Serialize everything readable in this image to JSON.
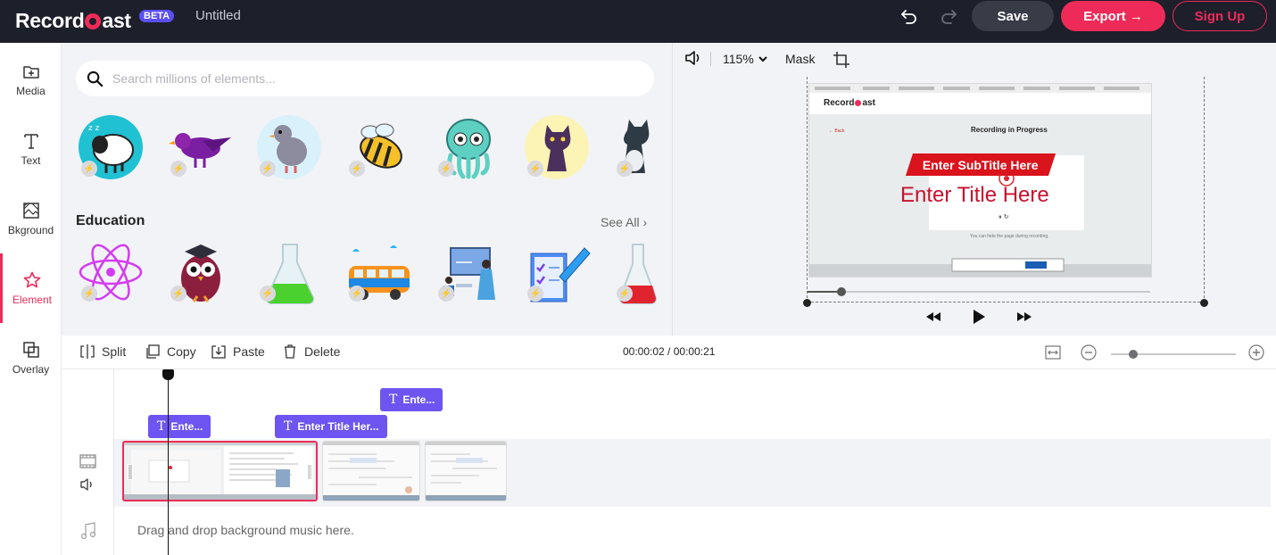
{
  "header": {
    "brand": "Record",
    "brand_suffix": "ast",
    "beta_badge": "BETA",
    "doc_title": "Untitled",
    "undo_icon": "undo-icon",
    "redo_icon": "redo-icon",
    "save_label": "Save",
    "export_label": "Export →",
    "signup_label": "Sign Up"
  },
  "sidebar": {
    "items": [
      {
        "label": "Media",
        "icon": "media-add-icon"
      },
      {
        "label": "Text",
        "icon": "text-icon"
      },
      {
        "label": "Bkground",
        "icon": "background-icon"
      },
      {
        "label": "Element",
        "icon": "star-icon",
        "active": true
      },
      {
        "label": "Overlay",
        "icon": "overlay-icon"
      }
    ]
  },
  "elements_panel": {
    "search_placeholder": "Search millions of elements...",
    "row1_items": [
      "sleeping-sheep",
      "purple-bird",
      "pigeon",
      "bee",
      "octopus",
      "cat",
      "cat-silhouette"
    ],
    "section_title": "Education",
    "see_all": "See All",
    "row2_items": [
      "atom",
      "owl-graduate",
      "flask",
      "school-bus",
      "teacher",
      "checklist-pencil",
      "test-tube"
    ]
  },
  "preview": {
    "zoom": "115%",
    "mask_label": "Mask",
    "video": {
      "browser_logo": "Record",
      "browser_logo_suffix": "ast",
      "recording_heading": "Recording in Progress",
      "back_link": "← Back",
      "subtitle_overlay": "Enter SubTitle Here",
      "title_overlay": "Enter Title Here",
      "hint": "You can hide the page during recording."
    },
    "progress": 0.1
  },
  "timeline": {
    "tools": [
      "Split",
      "Copy",
      "Paste",
      "Delete"
    ],
    "current_time": "00:00:02",
    "total_time": "00:00:21",
    "zoom_level": 0.18,
    "text_clips": [
      "Ente...",
      "Enter Title Her...",
      "Ente..."
    ],
    "music_placeholder": "Drag and drop background music here."
  },
  "colors": {
    "accent": "#ee2b58",
    "dark_bar": "#1d1f2b",
    "purple": "#6e54f0",
    "beta": "#5b4ff4",
    "title_red": "#c8102e"
  }
}
